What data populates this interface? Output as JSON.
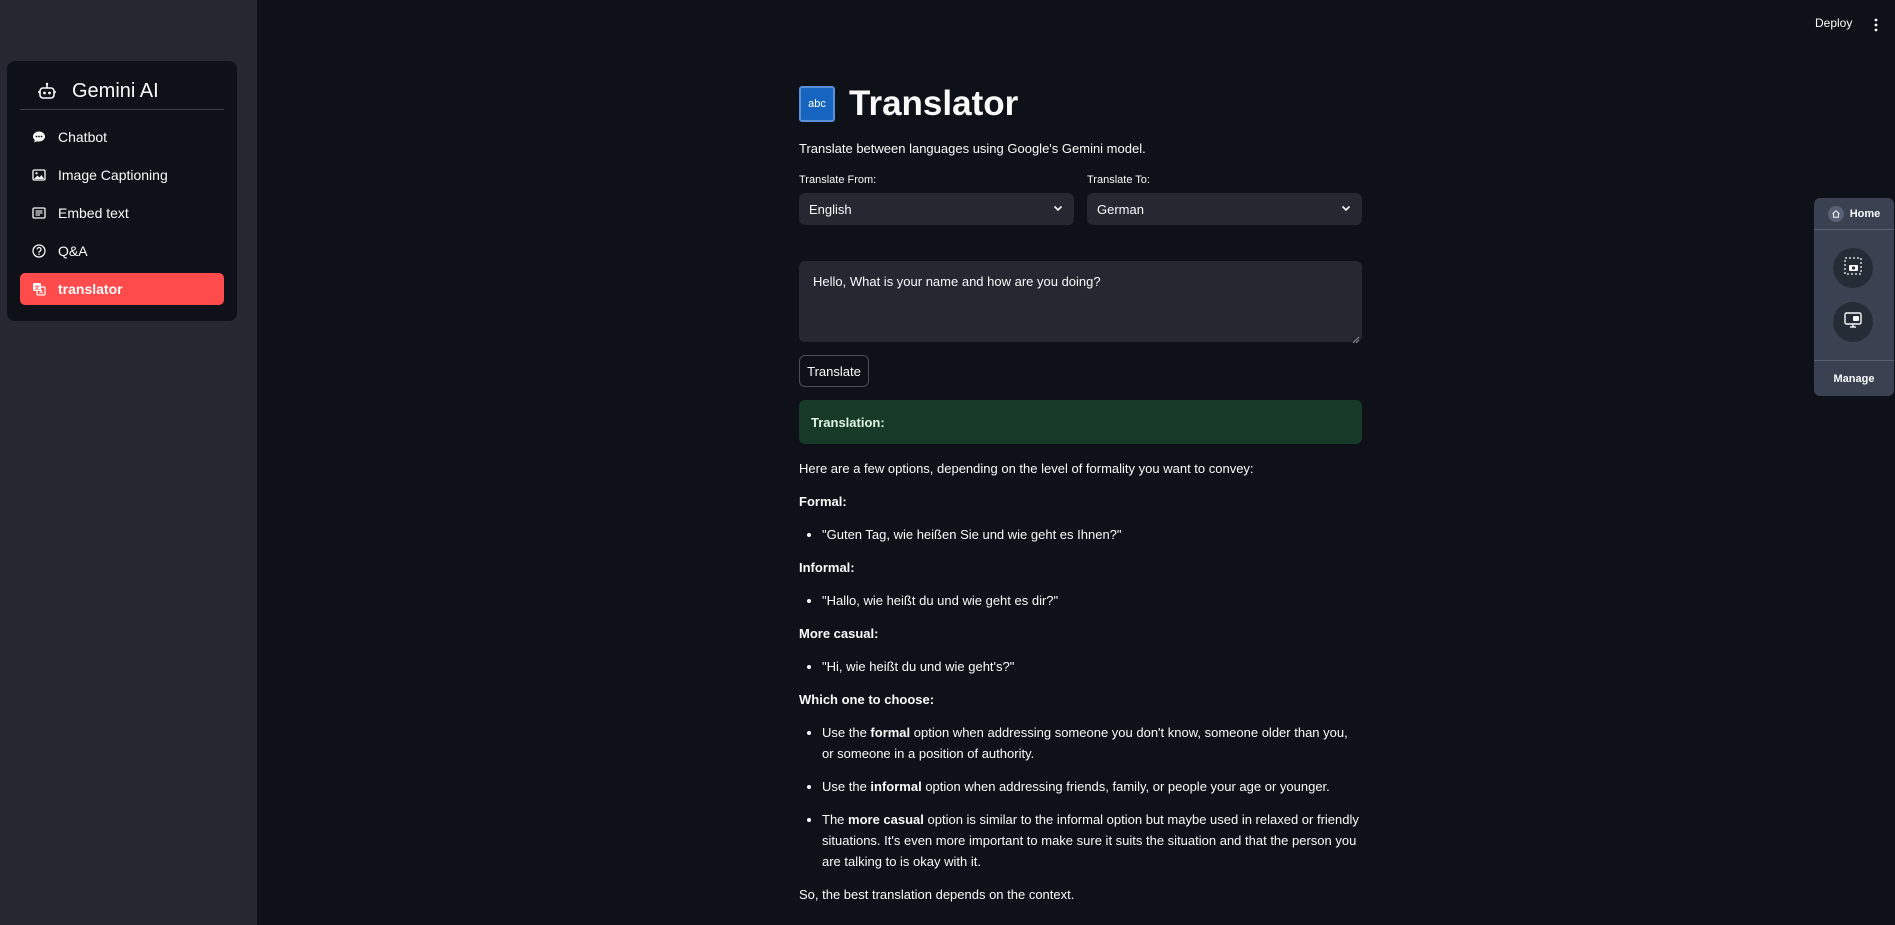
{
  "sidebar": {
    "title": "Gemini AI",
    "items": [
      {
        "label": "Chatbot",
        "icon": "chat-bubble-icon"
      },
      {
        "label": "Image Captioning",
        "icon": "image-icon"
      },
      {
        "label": "Embed text",
        "icon": "text-box-icon"
      },
      {
        "label": "Q&A",
        "icon": "question-circle-icon"
      },
      {
        "label": "translator",
        "icon": "translate-icon",
        "active": true
      }
    ],
    "active_color": "#ff4b4b"
  },
  "topbar": {
    "deploy_label": "Deploy"
  },
  "main": {
    "icon_text": "abc",
    "title": "Translator",
    "subtitle": "Translate between languages using Google's Gemini model.",
    "from_label": "Translate From:",
    "from_value": "English",
    "to_label": "Translate To:",
    "to_value": "German",
    "input_text": "Hello, What is your name and how are you doing?",
    "translate_button": "Translate",
    "result_label": "Translation:",
    "result_color": "#173928"
  },
  "output": {
    "intro": "Here are a few options, depending on the level of formality you want to convey:",
    "formal_heading": "Formal:",
    "formal_text": "\"Guten Tag, wie heißen Sie und wie geht es Ihnen?\"",
    "informal_heading": "Informal:",
    "informal_text": "\"Hallo, wie heißt du und wie geht es dir?\"",
    "casual_heading": "More casual:",
    "casual_text": "\"Hi, wie heißt du und wie geht's?\"",
    "choose_heading": "Which one to choose:",
    "choose_1_pre": "Use the ",
    "choose_1_bold": "formal",
    "choose_1_post": " option when addressing someone you don't know, someone older than you, or someone in a position of authority.",
    "choose_2_pre": "Use the ",
    "choose_2_bold": "informal",
    "choose_2_post": " option when addressing friends, family, or people your age or younger.",
    "choose_3_pre": "The ",
    "choose_3_bold": "more casual",
    "choose_3_post": " option is similar to the informal option but maybe used in relaxed or friendly situations. It's even more important to make sure it suits the situation and that the person you are talking to is okay with it.",
    "conclusion": "So, the best translation depends on the context."
  },
  "side_panel": {
    "home_label": "Home",
    "manage_label": "Manage"
  }
}
